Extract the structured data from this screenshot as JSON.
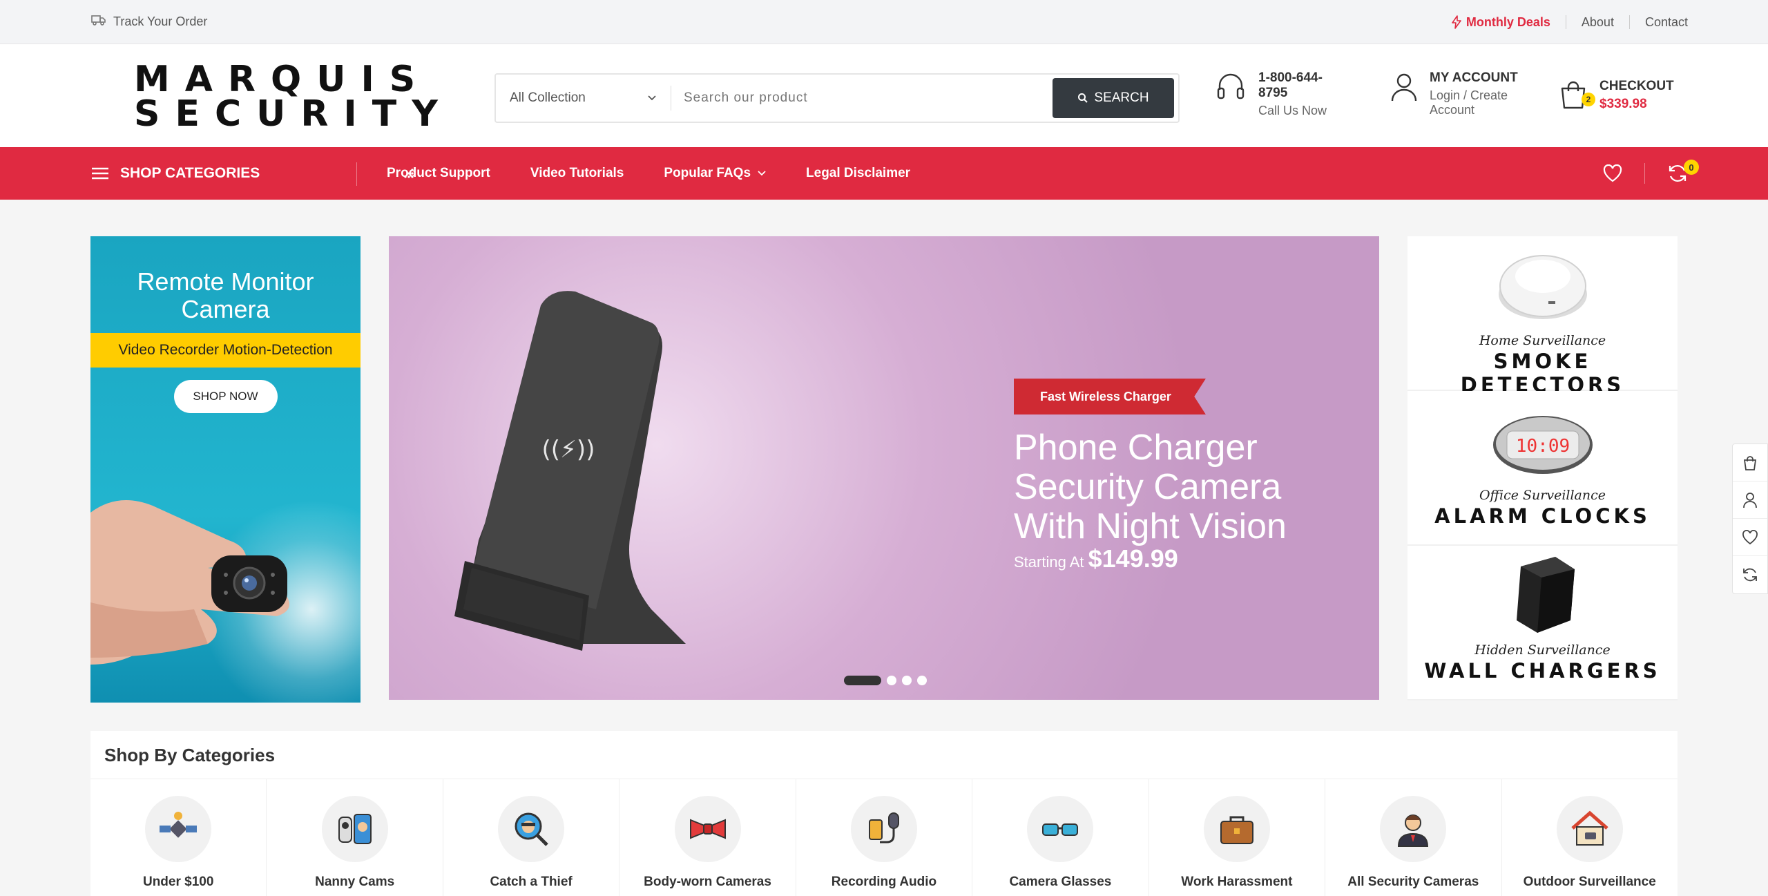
{
  "topbar": {
    "track_order": "Track Your Order",
    "monthly_deals": "Monthly Deals",
    "about": "About",
    "contact": "Contact"
  },
  "brand": {
    "line1": "MARQUIS",
    "line2": "SECURITY",
    "accent_color": "#e02a41"
  },
  "search": {
    "collection_selected": "All Collection",
    "placeholder": "Search our product",
    "button": "SEARCH"
  },
  "support": {
    "phone": "1-800-644-8795",
    "subtitle": "Call Us Now"
  },
  "account": {
    "title": "MY ACCOUNT",
    "subtitle": "Login / Create Account"
  },
  "cart": {
    "title": "CHECKOUT",
    "total": "$339.98",
    "count": "2"
  },
  "nav": {
    "shop_categories": "SHOP CATEGORIES",
    "items": [
      "Product Support",
      "Video Tutorials",
      "Popular FAQs",
      "Legal Disclaimer"
    ],
    "compare_count": "0"
  },
  "promo_left": {
    "title": "Remote Monitor Camera",
    "strip": "Video Recorder Motion-Detection",
    "button": "SHOP NOW"
  },
  "slider": {
    "tag": "Fast Wireless Charger",
    "title": "Phone Charger Security Camera With Night Vision",
    "price_prefix": "Starting At",
    "price": "$149.99",
    "slide_count": 4,
    "active_slide": 1
  },
  "right_promos": [
    {
      "sub": "Home Surveillance",
      "big": "SMOKE DETECTORS"
    },
    {
      "sub": "Office Surveillance",
      "big": "ALARM CLOCKS"
    },
    {
      "sub": "Hidden Surveillance",
      "big": "WALL CHARGERS"
    }
  ],
  "shop_by_categories": {
    "heading": "Shop By Categories",
    "items": [
      {
        "label": "Under $100",
        "icon": "satellite-icon"
      },
      {
        "label": "Nanny Cams",
        "icon": "baby-monitor-icon"
      },
      {
        "label": "Catch a Thief",
        "icon": "thief-magnifier-icon"
      },
      {
        "label": "Body-worn Cameras",
        "icon": "bow-tie-icon"
      },
      {
        "label": "Recording Audio",
        "icon": "audio-recorder-icon"
      },
      {
        "label": "Camera Glasses",
        "icon": "glasses-icon"
      },
      {
        "label": "Work Harassment",
        "icon": "briefcase-icon"
      },
      {
        "label": "All Security Cameras",
        "icon": "security-guard-icon"
      },
      {
        "label": "Outdoor Surveillance",
        "icon": "house-camera-icon"
      }
    ]
  }
}
